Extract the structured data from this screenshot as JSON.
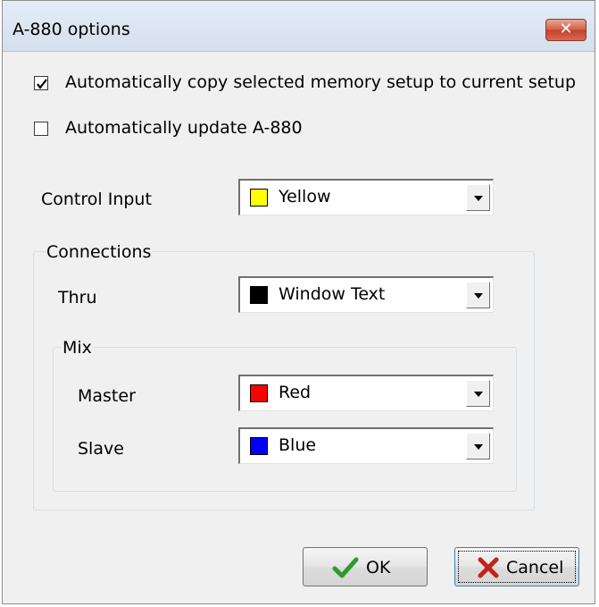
{
  "window": {
    "title": "A-880 options",
    "close_symbol": "✕"
  },
  "options": {
    "auto_copy": {
      "label": "Automatically copy selected memory setup to current setup",
      "checked": true
    },
    "auto_update": {
      "label": "Automatically update A-880",
      "checked": false
    }
  },
  "control_input": {
    "label": "Control Input",
    "value": "Yellow",
    "color": "#ffff00"
  },
  "connections": {
    "label": "Connections",
    "thru": {
      "label": "Thru",
      "value": "Window Text",
      "color": "#000000"
    },
    "mix": {
      "label": "Mix",
      "master": {
        "label": "Master",
        "value": "Red",
        "color": "#ff0000"
      },
      "slave": {
        "label": "Slave",
        "value": "Blue",
        "color": "#0000ff"
      }
    }
  },
  "buttons": {
    "ok": {
      "label": "OK",
      "icon": "checkmark-icon",
      "icon_color": "#2e9a2e"
    },
    "cancel": {
      "label": "Cancel",
      "icon": "cross-icon",
      "icon_color": "#c0241a"
    }
  }
}
